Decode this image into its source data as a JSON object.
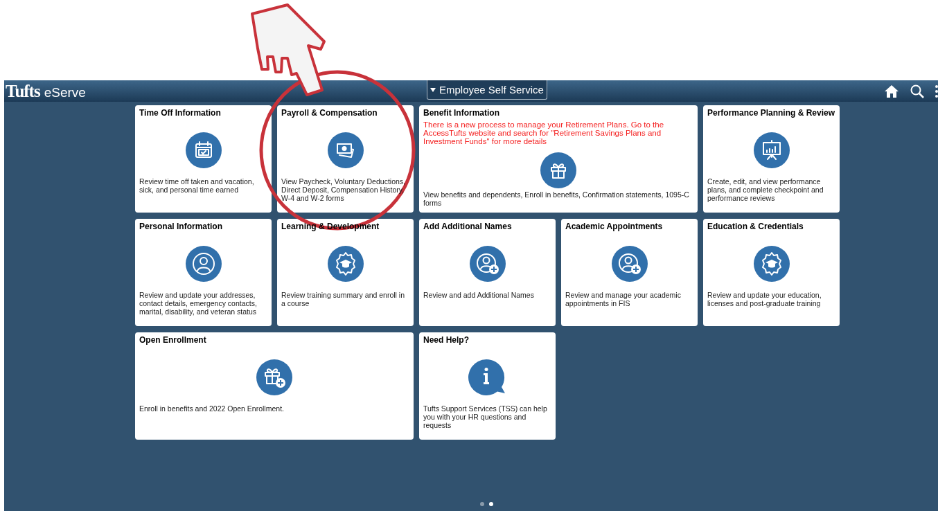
{
  "header": {
    "logo_main": "Tufts",
    "logo_sub": "eServe",
    "homepage_selector": "Employee Self Service"
  },
  "tiles": [
    {
      "kind": "single",
      "title": "Time Off Information",
      "description": "Review time off taken and vacation, sick, and personal time earned"
    },
    {
      "kind": "single",
      "title": "Payroll & Compensation",
      "description": "View Paycheck, Voluntary Deductions, Direct Deposit, Compensation History, W-4 and W-2 forms"
    },
    {
      "kind": "double",
      "title": "Benefit Information",
      "notice": "There is a new process to manage your Retirement Plans. Go to the AccessTufts website and search for \"Retirement Savings Plans and Investment Funds\" for more details",
      "description": "View benefits and dependents, Enroll in benefits, Confirmation statements, 1095-C forms"
    },
    {
      "kind": "single",
      "title": "Performance Planning & Review",
      "description": "Create, edit, and view performance plans, and complete checkpoint and performance reviews"
    },
    {
      "kind": "single",
      "title": "Personal Information",
      "description": "Review and update your addresses, contact details, emergency contacts, marital, disability, and veteran status"
    },
    {
      "kind": "single",
      "title": "Learning & Development",
      "description": "Review training summary and enroll in a course"
    },
    {
      "kind": "single",
      "title": "Add Additional Names",
      "description": "Review and add Additional Names"
    },
    {
      "kind": "single",
      "title": "Academic Appointments",
      "description": "Review and manage your academic appointments in FIS"
    },
    {
      "kind": "single",
      "title": "Education & Credentials",
      "description": "Review and update your education, licenses and post-graduate training"
    },
    {
      "kind": "double",
      "title": "Open Enrollment",
      "description": "Enroll in benefits and 2022 Open Enrollment."
    },
    {
      "kind": "single",
      "title": "Need Help?",
      "description": "Tufts Support Services (TSS) can help you with your HR questions and requests"
    }
  ],
  "pager": [
    {
      "selected": false
    },
    {
      "selected": true
    }
  ]
}
